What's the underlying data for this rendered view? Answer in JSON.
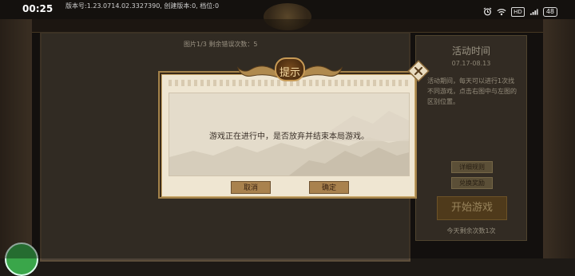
{
  "status_bar": {
    "time": "00:25",
    "build_info": "版本号:1.23.0714.02.3327390, 创建版本:0, 档位:0",
    "hd_badge": "HD",
    "battery": "48"
  },
  "game": {
    "info_text": "图片1/3   剩余错误次数：5"
  },
  "side_panel": {
    "title": "活动时间",
    "date_range": "07.17-08.13",
    "description": "活动期间，每天可以进行1次找不同游戏，点击右图中与左图的区别位置。",
    "rules_button": "详细规则",
    "exchange_button": "兑换奖励",
    "start_button": "开始游戏",
    "remaining_text": "今天剩余次数1次"
  },
  "dialog": {
    "title": "提示",
    "message": "游戏正在进行中，是否放弃并结束本局游戏。",
    "cancel_label": "取消",
    "confirm_label": "确定"
  },
  "icons": {
    "close": "close-icon",
    "alarm": "alarm-icon",
    "wifi": "wifi-icon",
    "battery": "battery-icon"
  },
  "colors": {
    "dialog_frame": "#a3824a",
    "dialog_paper": "#efe6d2",
    "button": "#a9824e",
    "panel": "#4d4236",
    "start_button": "#7a5a2a"
  }
}
